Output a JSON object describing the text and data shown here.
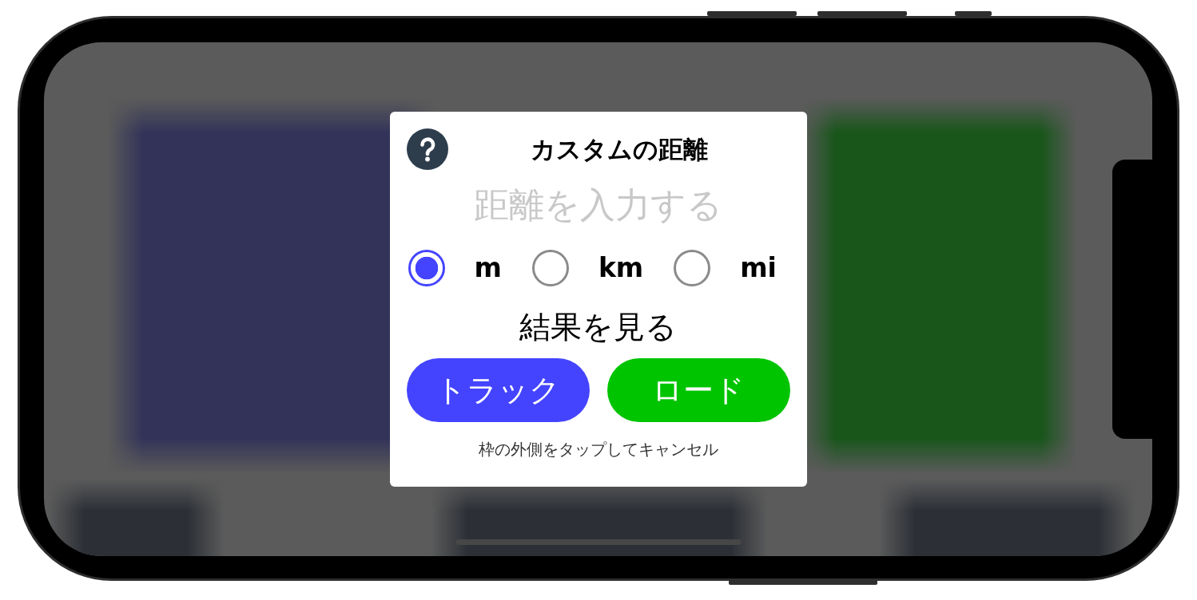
{
  "dialog": {
    "title": "カスタムの距離",
    "distance_field": {
      "placeholder": "距離を入力する"
    },
    "units": [
      {
        "label": "m",
        "selected": true
      },
      {
        "label": "km",
        "selected": false
      },
      {
        "label": "mi",
        "selected": false
      }
    ],
    "results_label": "結果を見る",
    "result_buttons": [
      {
        "label": "トラック",
        "color": "#4444ff"
      },
      {
        "label": "ロード",
        "color": "#00c400"
      }
    ],
    "hint": "枠の外側をタップしてキャンセル"
  }
}
